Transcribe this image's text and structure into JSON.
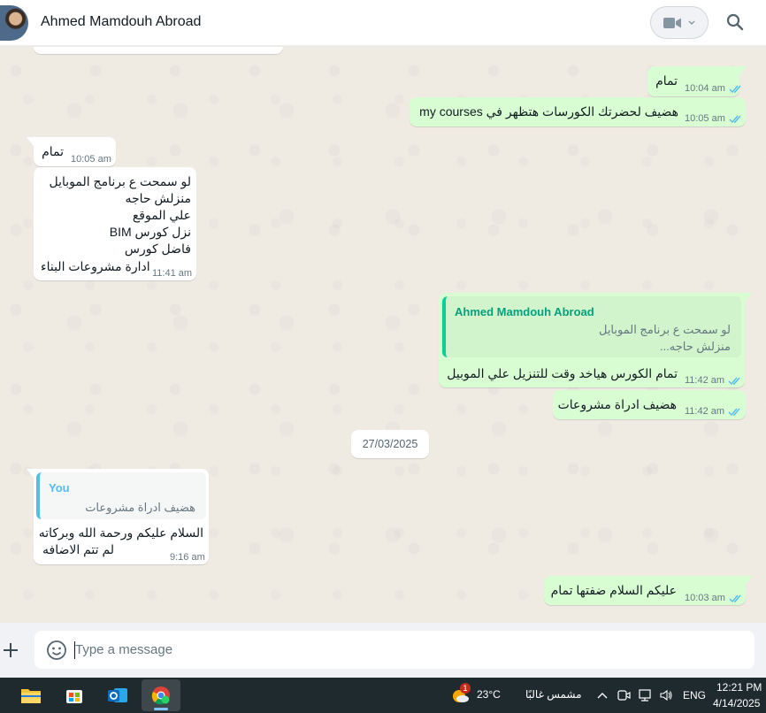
{
  "header": {
    "contact_name": "Ahmed Mamdouh Abroad"
  },
  "messages": [
    {
      "text": "تمام",
      "time": "10:04 am"
    },
    {
      "text": "هضيف لحضرتك الكورسات هتظهر في my courses",
      "time": "10:05 am"
    },
    {
      "text": "تمام",
      "time": "10:05 am"
    },
    {
      "lines": [
        "لو سمحت ع برنامج الموبايل",
        "منزلش حاجه",
        "علي الموقع",
        "نزل كورس BIM",
        "فاضل كورس",
        "ادارة مشروعات البناء"
      ],
      "time": "11:41 am"
    },
    {
      "quote_author": "Ahmed Mamdouh Abroad",
      "quote_lines": [
        "لو سمحت ع برنامج الموبايل",
        "منزلش حاجه..."
      ],
      "text": "تمام الكورس هياخد وقت للتنزيل علي الموبيل",
      "time": "11:42 am"
    },
    {
      "text": "هضيف ادراة مشروعات",
      "time": "11:42 am"
    },
    {
      "quote_author": "You",
      "quote_line": "هضيف ادراة مشروعات",
      "lines": [
        "السلام عليكم ورحمة الله وبركاته",
        "لم تتم الاضافه"
      ],
      "time": "9:16 am"
    },
    {
      "text": "عليكم السلام ضفتها تمام",
      "time": "10:03 am"
    }
  ],
  "date_divider": "27/03/2025",
  "composer": {
    "placeholder": "Type a message"
  },
  "taskbar": {
    "weather_badge": "1",
    "temperature": "23°C",
    "weather_text": "مشمس غالبًا",
    "language": "ENG",
    "time": "12:21 PM",
    "date": "4/14/2025"
  },
  "colors": {
    "outgoing_bubble": "#d9fdd3",
    "incoming_bubble": "#ffffff",
    "read_ticks": "#53bdeb",
    "quote_out_accent": "#06cf9c",
    "quote_in_accent": "#53bdeb",
    "chat_background": "#efeae2"
  }
}
